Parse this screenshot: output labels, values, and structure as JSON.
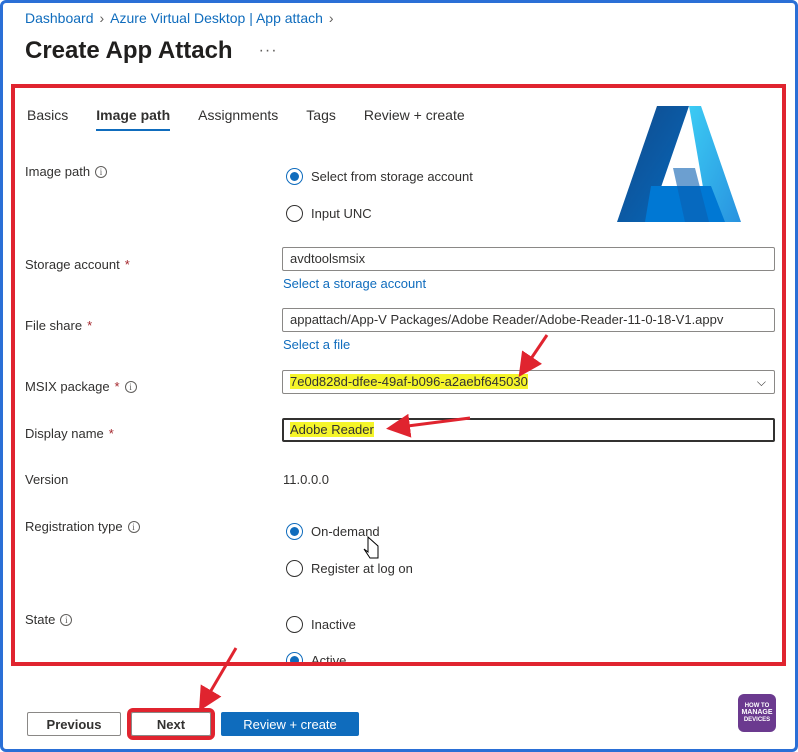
{
  "breadcrumb": {
    "items": [
      "Dashboard",
      "Azure Virtual Desktop | App attach"
    ]
  },
  "page": {
    "title": "Create App Attach",
    "more": "···"
  },
  "tabs": [
    "Basics",
    "Image path",
    "Assignments",
    "Tags",
    "Review + create"
  ],
  "active_tab": "Image path",
  "form": {
    "image_path": {
      "label": "Image path",
      "options": [
        "Select from storage account",
        "Input UNC"
      ],
      "selected": "Select from storage account"
    },
    "storage_account": {
      "label": "Storage account",
      "required_mark": "*",
      "value": "avdtoolsmsix",
      "link": "Select a storage account"
    },
    "file_share": {
      "label": "File share",
      "required_mark": "*",
      "value": "appattach/App-V Packages/Adobe Reader/Adobe-Reader-11-0-18-V1.appv",
      "link": "Select a file"
    },
    "msix_package": {
      "label": "MSIX package",
      "required_mark": "*",
      "value": "7e0d828d-dfee-49af-b096-a2aebf645030"
    },
    "display_name": {
      "label": "Display name",
      "required_mark": "*",
      "value": "Adobe Reader"
    },
    "version": {
      "label": "Version",
      "value": "11.0.0.0"
    },
    "registration_type": {
      "label": "Registration type",
      "options": [
        "On-demand",
        "Register at log on"
      ],
      "selected": "On-demand"
    },
    "state": {
      "label": "State",
      "options": [
        "Inactive",
        "Active"
      ],
      "selected": "Active"
    }
  },
  "footer": {
    "previous": "Previous",
    "next": "Next",
    "review_create": "Review + create"
  },
  "watermark": {
    "line1": "HOW TO",
    "line2": "MANAGE",
    "line3": "DEVICES"
  },
  "colors": {
    "accent": "#0f6cbd",
    "highlight_box": "#e0242f",
    "text_highlight": "#f5f52a",
    "azure_logo": "#1b7bd8"
  }
}
